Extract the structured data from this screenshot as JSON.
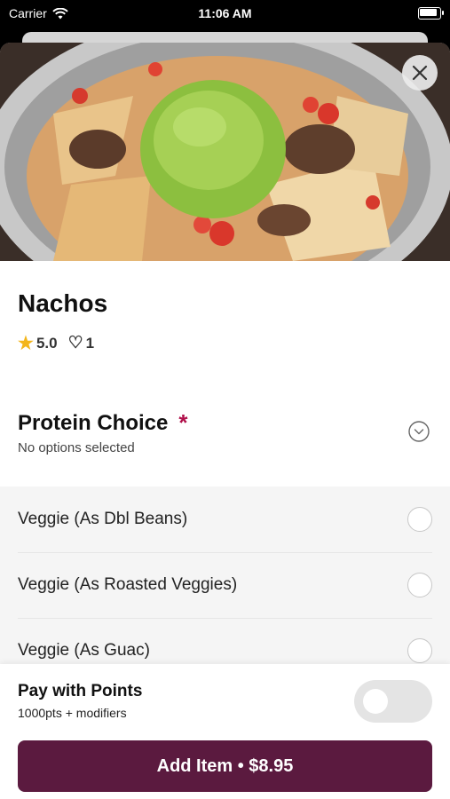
{
  "status_bar": {
    "carrier": "Carrier",
    "time": "11:06 AM"
  },
  "item": {
    "name": "Nachos",
    "rating": "5.0",
    "likes": "1"
  },
  "protein": {
    "title": "Protein Choice",
    "required_mark": "*",
    "subtitle": "No options selected",
    "options": [
      {
        "label": "Veggie (As Dbl Beans)"
      },
      {
        "label": "Veggie (As Roasted Veggies)"
      },
      {
        "label": "Veggie (As Guac)"
      }
    ]
  },
  "points": {
    "title": "Pay with Points",
    "subtitle": "1000pts + modifiers",
    "enabled": false
  },
  "add_button": {
    "label": "Add Item • $8.95"
  },
  "colors": {
    "brand": "#5b1a3f",
    "required": "#b0104a",
    "star": "#f3b51b"
  },
  "icons": [
    "wifi-icon",
    "battery-icon",
    "close-icon",
    "star-icon",
    "heart-icon",
    "chevron-down-icon",
    "radio-icon"
  ]
}
